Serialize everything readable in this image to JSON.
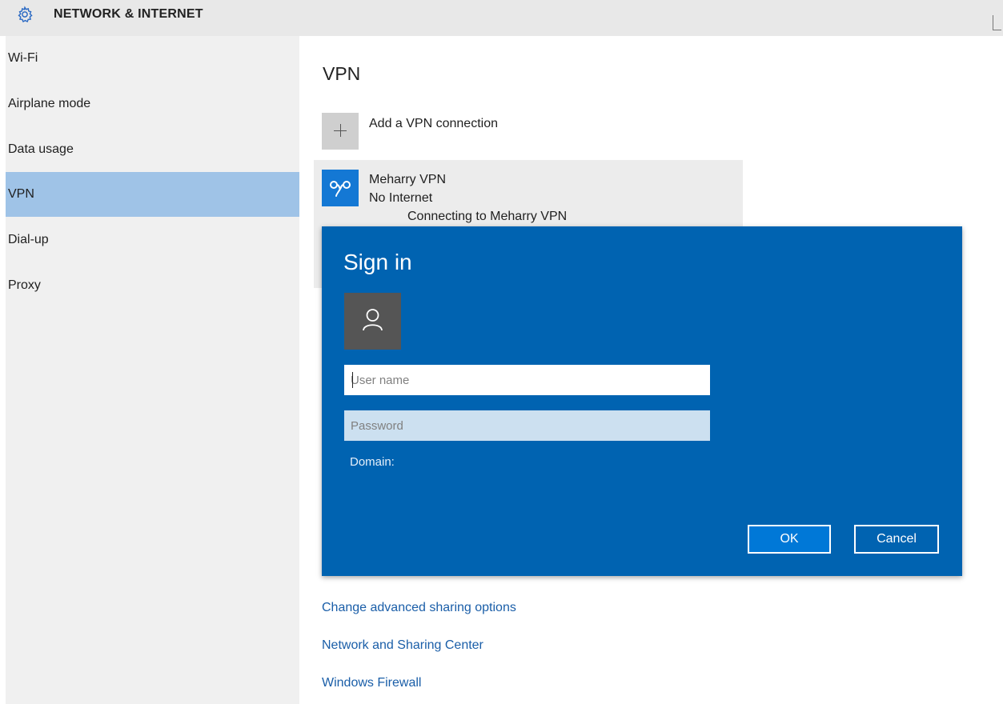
{
  "header": {
    "title": "NETWORK & INTERNET",
    "icon": "gear-icon"
  },
  "sidebar": {
    "items": [
      {
        "label": "Wi-Fi",
        "active": false
      },
      {
        "label": "Airplane mode",
        "active": false
      },
      {
        "label": "Data usage",
        "active": false
      },
      {
        "label": "VPN",
        "active": true
      },
      {
        "label": "Dial-up",
        "active": false
      },
      {
        "label": "Proxy",
        "active": false
      }
    ]
  },
  "main": {
    "title": "VPN",
    "add_vpn_label": "Add a VPN connection",
    "vpn": {
      "name": "Meharry VPN",
      "status": "No Internet",
      "connecting_text": "Connecting to Meharry VPN",
      "icon": "vpn-icon"
    },
    "links": [
      "Change advanced sharing options",
      "Network and Sharing Center",
      "Windows Firewall"
    ]
  },
  "dialog": {
    "title": "Sign in",
    "avatar_icon": "user-icon",
    "username_placeholder": "User name",
    "password_placeholder": "Password",
    "domain_label": "Domain:",
    "ok_label": "OK",
    "cancel_label": "Cancel"
  },
  "colors": {
    "dialog_bg": "#0063b1",
    "sidebar_active": "#9fc3e7",
    "link": "#1a5ea8",
    "vpn_icon_bg": "#1478d4"
  }
}
